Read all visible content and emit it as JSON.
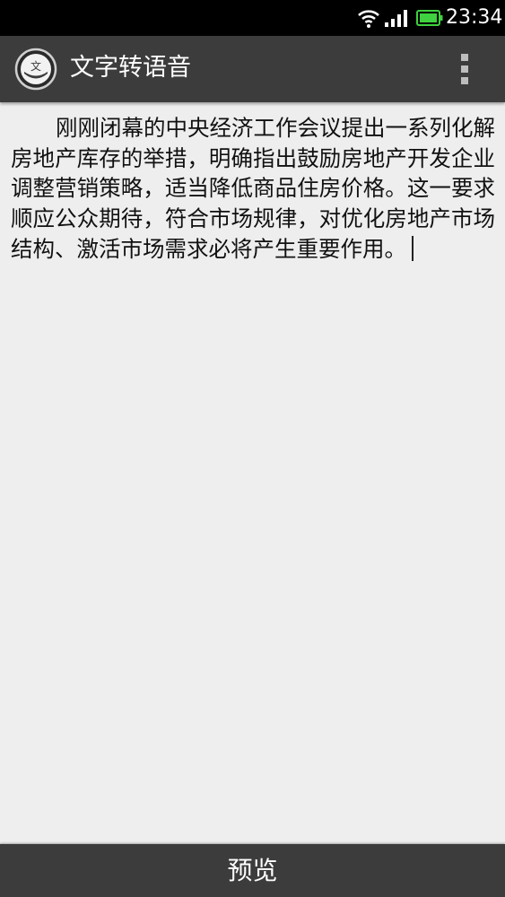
{
  "status_bar": {
    "time": "23:34",
    "icons": [
      "wifi-icon",
      "signal-icon",
      "battery-icon"
    ],
    "battery_color": "#3fd13f"
  },
  "action_bar": {
    "title": "文字转语音",
    "app_icon_glyph": "文",
    "background_color": "#3c3c3c"
  },
  "editor": {
    "text": "刚刚闭幕的中央经济工作会议提出一系列化解房地产库存的举措，明确指出鼓励房地产开发企业调整营销策略，适当降低商品住房价格。这一要求顺应公众期待，符合市场规律，对优化房地产市场结构、激活市场需求必将产生重要作用。"
  },
  "bottom_bar": {
    "preview_label": "预览"
  }
}
